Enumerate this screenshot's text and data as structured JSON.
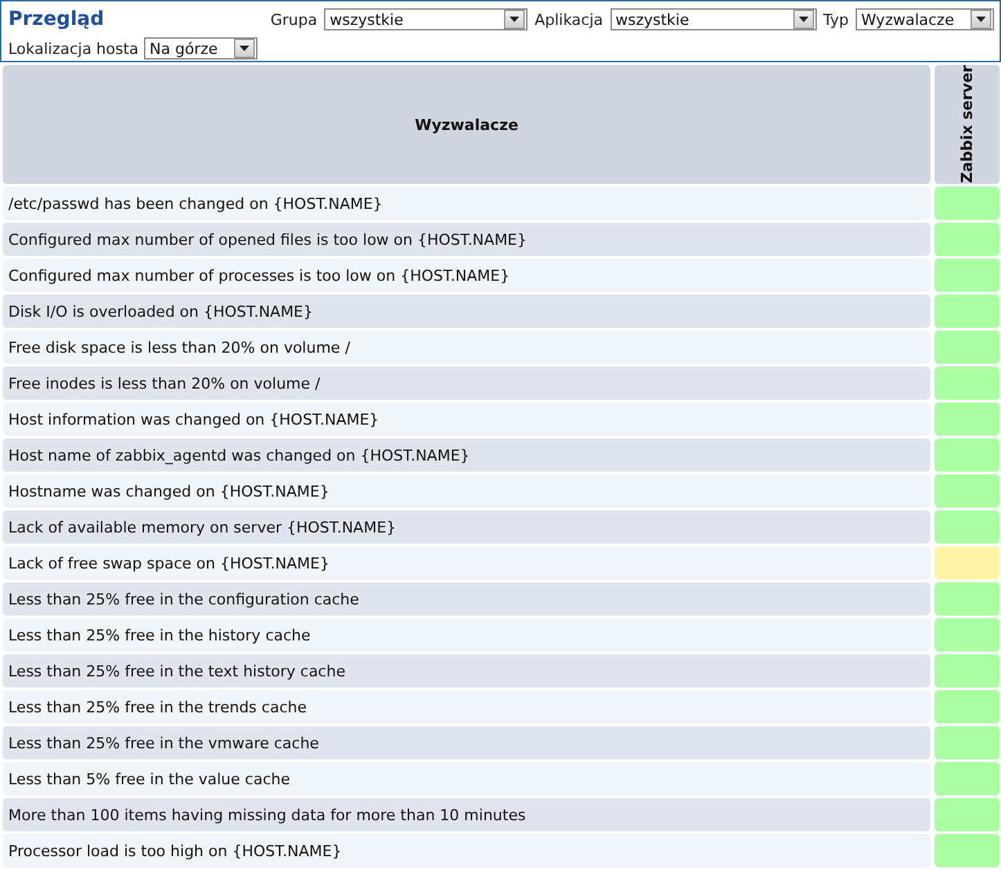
{
  "header": {
    "title": "Przegląd",
    "filters": [
      {
        "label": "Grupa",
        "value": "wszystkie"
      },
      {
        "label": "Aplikacja",
        "value": "wszystkie"
      },
      {
        "label": "Typ",
        "value": "Wyzwalacze"
      }
    ],
    "host_location": {
      "label": "Lokalizacja hosta",
      "value": "Na górze"
    }
  },
  "table": {
    "columns": [
      "Wyzwalacze",
      "Zabbix server"
    ],
    "rows": [
      {
        "trigger": "/etc/passwd has been changed on {HOST.NAME}",
        "color": "#aaffa3"
      },
      {
        "trigger": "Configured max number of opened files is too low on {HOST.NAME}",
        "color": "#aaffa3"
      },
      {
        "trigger": "Configured max number of processes is too low on {HOST.NAME}",
        "color": "#aaffa3"
      },
      {
        "trigger": "Disk I/O is overloaded on {HOST.NAME}",
        "color": "#aaffa3"
      },
      {
        "trigger": "Free disk space is less than 20% on volume /",
        "color": "#aaffa3"
      },
      {
        "trigger": "Free inodes is less than 20% on volume /",
        "color": "#aaffa3"
      },
      {
        "trigger": "Host information was changed on {HOST.NAME}",
        "color": "#aaffa3"
      },
      {
        "trigger": "Host name of zabbix_agentd was changed on {HOST.NAME}",
        "color": "#aaffa3"
      },
      {
        "trigger": "Hostname was changed on {HOST.NAME}",
        "color": "#aaffa3"
      },
      {
        "trigger": "Lack of available memory on server {HOST.NAME}",
        "color": "#aaffa3"
      },
      {
        "trigger": "Lack of free swap space on {HOST.NAME}",
        "color": "#fff6a5"
      },
      {
        "trigger": "Less than 25% free in the configuration cache",
        "color": "#aaffa3"
      },
      {
        "trigger": "Less than 25% free in the history cache",
        "color": "#aaffa3"
      },
      {
        "trigger": "Less than 25% free in the text history cache",
        "color": "#aaffa3"
      },
      {
        "trigger": "Less than 25% free in the trends cache",
        "color": "#aaffa3"
      },
      {
        "trigger": "Less than 25% free in the vmware cache",
        "color": "#aaffa3"
      },
      {
        "trigger": "Less than 5% free in the value cache",
        "color": "#aaffa3"
      },
      {
        "trigger": "More than 100 items having missing data for more than 10 minutes",
        "color": "#aaffa3"
      },
      {
        "trigger": "Processor load is too high on {HOST.NAME}",
        "color": "#aaffa3"
      }
    ]
  }
}
